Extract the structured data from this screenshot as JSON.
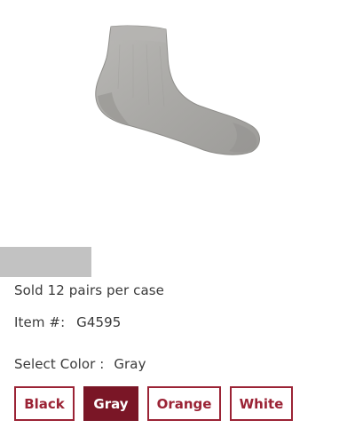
{
  "product": {
    "image_alt": "gray ankle sock",
    "pairs_text": "Sold 12 pairs per case",
    "item_label": "Item #:",
    "item_value": "G4595",
    "color_label": "Select Color :",
    "color_value": "Gray"
  },
  "color_options": [
    {
      "label": "Black",
      "selected": false
    },
    {
      "label": "Gray",
      "selected": true
    },
    {
      "label": "Orange",
      "selected": false
    },
    {
      "label": "White",
      "selected": false
    }
  ],
  "colors": {
    "accent": "#9b2335",
    "selected_fill": "#7a1626",
    "bar_gray": "#c2c2c2"
  }
}
